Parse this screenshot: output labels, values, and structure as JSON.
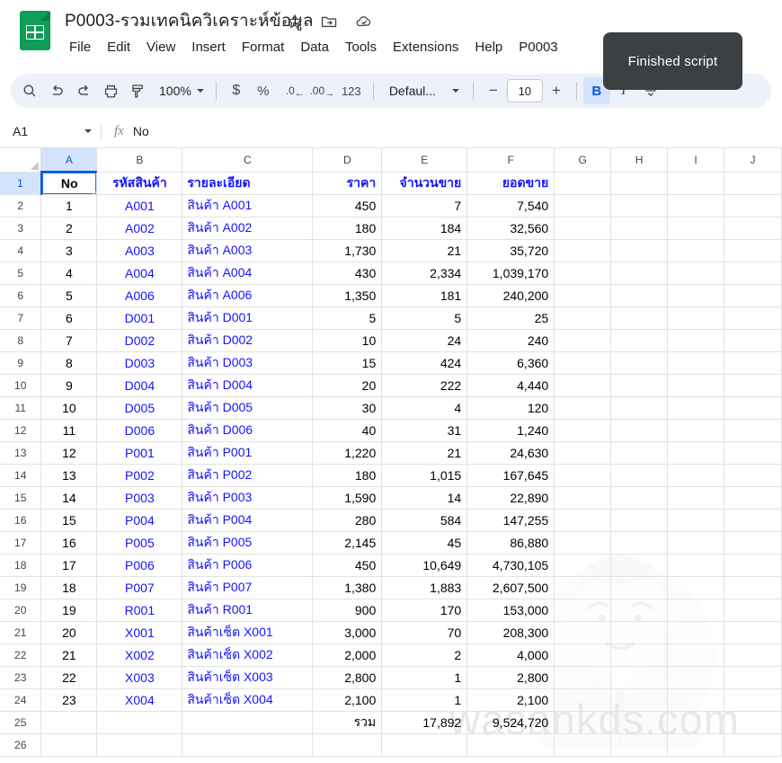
{
  "header": {
    "doc_title": "P0003-รวมเทคนิควิเคราะห์ข้อมูล",
    "icons": [
      {
        "name": "star-icon",
        "label": "Star"
      },
      {
        "name": "move-to-folder-icon",
        "label": "Move"
      },
      {
        "name": "cloud-saved-icon",
        "label": "Saved to Drive"
      }
    ],
    "menus": [
      "File",
      "Edit",
      "View",
      "Insert",
      "Format",
      "Data",
      "Tools",
      "Extensions",
      "Help",
      "P0003"
    ]
  },
  "toolbar": {
    "search_label": "Search",
    "undo_label": "Undo",
    "redo_label": "Redo",
    "print_label": "Print",
    "paint_format_label": "Paint format",
    "zoom_value": "100%",
    "currency_label": "$",
    "percent_label": "%",
    "decrease_decimal_label": ".0",
    "increase_decimal_label": ".00",
    "more_formats_label": "123",
    "font_family": "Defaul...",
    "font_size_decrease": "−",
    "font_size": "10",
    "font_size_increase": "+",
    "bold_label": "B",
    "italic_label": "I",
    "strikethrough_label": "S"
  },
  "tooltip": {
    "text": "Finished script"
  },
  "formula_bar": {
    "name_box": "A1",
    "fx_label": "fx",
    "value": "No"
  },
  "grid": {
    "columns": [
      "A",
      "B",
      "C",
      "D",
      "E",
      "F",
      "G",
      "H",
      "I",
      "J"
    ],
    "selected_cell": "A1",
    "rows": [
      {
        "n": "1",
        "cells": [
          "No",
          "รหัสสินค้า",
          "รายละเอียด",
          "ราคา",
          "จำนวนขาย",
          "ยอดขาย",
          "",
          "",
          "",
          ""
        ]
      },
      {
        "n": "2",
        "cells": [
          "1",
          "A001",
          "สินค้า A001",
          "450",
          "7",
          "7,540",
          "",
          "",
          "",
          ""
        ]
      },
      {
        "n": "3",
        "cells": [
          "2",
          "A002",
          "สินค้า A002",
          "180",
          "184",
          "32,560",
          "",
          "",
          "",
          ""
        ]
      },
      {
        "n": "4",
        "cells": [
          "3",
          "A003",
          "สินค้า A003",
          "1,730",
          "21",
          "35,720",
          "",
          "",
          "",
          ""
        ]
      },
      {
        "n": "5",
        "cells": [
          "4",
          "A004",
          "สินค้า A004",
          "430",
          "2,334",
          "1,039,170",
          "",
          "",
          "",
          ""
        ]
      },
      {
        "n": "6",
        "cells": [
          "5",
          "A006",
          "สินค้า A006",
          "1,350",
          "181",
          "240,200",
          "",
          "",
          "",
          ""
        ]
      },
      {
        "n": "7",
        "cells": [
          "6",
          "D001",
          "สินค้า D001",
          "5",
          "5",
          "25",
          "",
          "",
          "",
          ""
        ]
      },
      {
        "n": "8",
        "cells": [
          "7",
          "D002",
          "สินค้า D002",
          "10",
          "24",
          "240",
          "",
          "",
          "",
          ""
        ]
      },
      {
        "n": "9",
        "cells": [
          "8",
          "D003",
          "สินค้า D003",
          "15",
          "424",
          "6,360",
          "",
          "",
          "",
          ""
        ]
      },
      {
        "n": "10",
        "cells": [
          "9",
          "D004",
          "สินค้า D004",
          "20",
          "222",
          "4,440",
          "",
          "",
          "",
          ""
        ]
      },
      {
        "n": "11",
        "cells": [
          "10",
          "D005",
          "สินค้า D005",
          "30",
          "4",
          "120",
          "",
          "",
          "",
          ""
        ]
      },
      {
        "n": "12",
        "cells": [
          "11",
          "D006",
          "สินค้า D006",
          "40",
          "31",
          "1,240",
          "",
          "",
          "",
          ""
        ]
      },
      {
        "n": "13",
        "cells": [
          "12",
          "P001",
          "สินค้า P001",
          "1,220",
          "21",
          "24,630",
          "",
          "",
          "",
          ""
        ]
      },
      {
        "n": "14",
        "cells": [
          "13",
          "P002",
          "สินค้า P002",
          "180",
          "1,015",
          "167,645",
          "",
          "",
          "",
          ""
        ]
      },
      {
        "n": "15",
        "cells": [
          "14",
          "P003",
          "สินค้า P003",
          "1,590",
          "14",
          "22,890",
          "",
          "",
          "",
          ""
        ]
      },
      {
        "n": "16",
        "cells": [
          "15",
          "P004",
          "สินค้า P004",
          "280",
          "584",
          "147,255",
          "",
          "",
          "",
          ""
        ]
      },
      {
        "n": "17",
        "cells": [
          "16",
          "P005",
          "สินค้า P005",
          "2,145",
          "45",
          "86,880",
          "",
          "",
          "",
          ""
        ]
      },
      {
        "n": "18",
        "cells": [
          "17",
          "P006",
          "สินค้า P006",
          "450",
          "10,649",
          "4,730,105",
          "",
          "",
          "",
          ""
        ]
      },
      {
        "n": "19",
        "cells": [
          "18",
          "P007",
          "สินค้า P007",
          "1,380",
          "1,883",
          "2,607,500",
          "",
          "",
          "",
          ""
        ]
      },
      {
        "n": "20",
        "cells": [
          "19",
          "R001",
          "สินค้า R001",
          "900",
          "170",
          "153,000",
          "",
          "",
          "",
          ""
        ]
      },
      {
        "n": "21",
        "cells": [
          "20",
          "X001",
          "สินค้าเซ็ต X001",
          "3,000",
          "70",
          "208,300",
          "",
          "",
          "",
          ""
        ]
      },
      {
        "n": "22",
        "cells": [
          "21",
          "X002",
          "สินค้าเซ็ต X002",
          "2,000",
          "2",
          "4,000",
          "",
          "",
          "",
          ""
        ]
      },
      {
        "n": "23",
        "cells": [
          "22",
          "X003",
          "สินค้าเซ็ต X003",
          "2,800",
          "1",
          "2,800",
          "",
          "",
          "",
          ""
        ]
      },
      {
        "n": "24",
        "cells": [
          "23",
          "X004",
          "สินค้าเซ็ต X004",
          "2,100",
          "1",
          "2,100",
          "",
          "",
          "",
          ""
        ]
      },
      {
        "n": "25",
        "cells": [
          "",
          "",
          "",
          "รวม",
          "17,892",
          "9,524,720",
          "",
          "",
          "",
          ""
        ]
      },
      {
        "n": "26",
        "cells": [
          "",
          "",
          "",
          "",
          "",
          "",
          "",
          "",
          "",
          ""
        ]
      }
    ]
  },
  "watermark": {
    "text": "wasankds.com",
    "avatar_name": "person-avatar-watermark"
  },
  "colors": {
    "brand_green": "#0f9d58",
    "accent_blue": "#1a73e8",
    "data_blue": "#1414ff",
    "toolbar_bg": "#edf2fa",
    "tooltip_bg": "#3c4043"
  }
}
